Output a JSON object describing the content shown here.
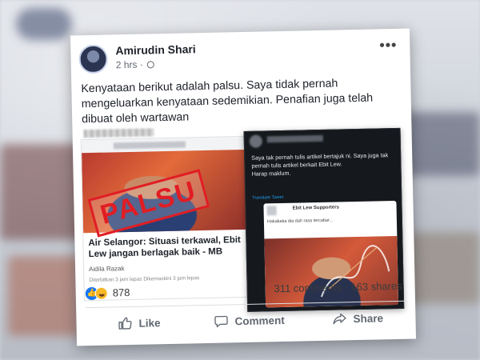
{
  "post": {
    "author": "Amirudin Shari",
    "time": "2 hrs · ",
    "text": "Kenyataan berikut adalah palsu. Saya tidak pernah mengeluarkan kenyataan sedemikian. Penafian juga telah dibuat oleh wartawan"
  },
  "left_shot": {
    "stamp": "PALSU",
    "headline": "Air Selangor: Situasi terkawal, Ebit Lew jangan berlagak baik - MB",
    "byline": "Aidila Razak",
    "date_line": "Diterbitkan 3 jam lepas    Dikemaskini 3 jam lepas"
  },
  "right_shot": {
    "tweet": "Saya tak pernah tulis artikel bertajuk ni. Saya juga tak pernah tulis artikel berkait Ebit Lew.\nHarap maklum.",
    "translate": "Translate Tweet",
    "inner_title": "Ebit Lew Supporters",
    "inner_text": "Hakakaka dia dah rasa tercabar..."
  },
  "stats": {
    "reactions_count": "878",
    "comments_shares": "311 comments · 163 shares"
  },
  "actions": {
    "like": "Like",
    "comment": "Comment",
    "share": "Share"
  },
  "icons": [
    "more-icon",
    "globe-icon",
    "like-reaction-icon",
    "haha-reaction-icon",
    "like-icon",
    "comment-icon",
    "share-icon"
  ],
  "colors": {
    "facebook_blue": "#1877f2",
    "stamp_red": "#e11d24"
  }
}
